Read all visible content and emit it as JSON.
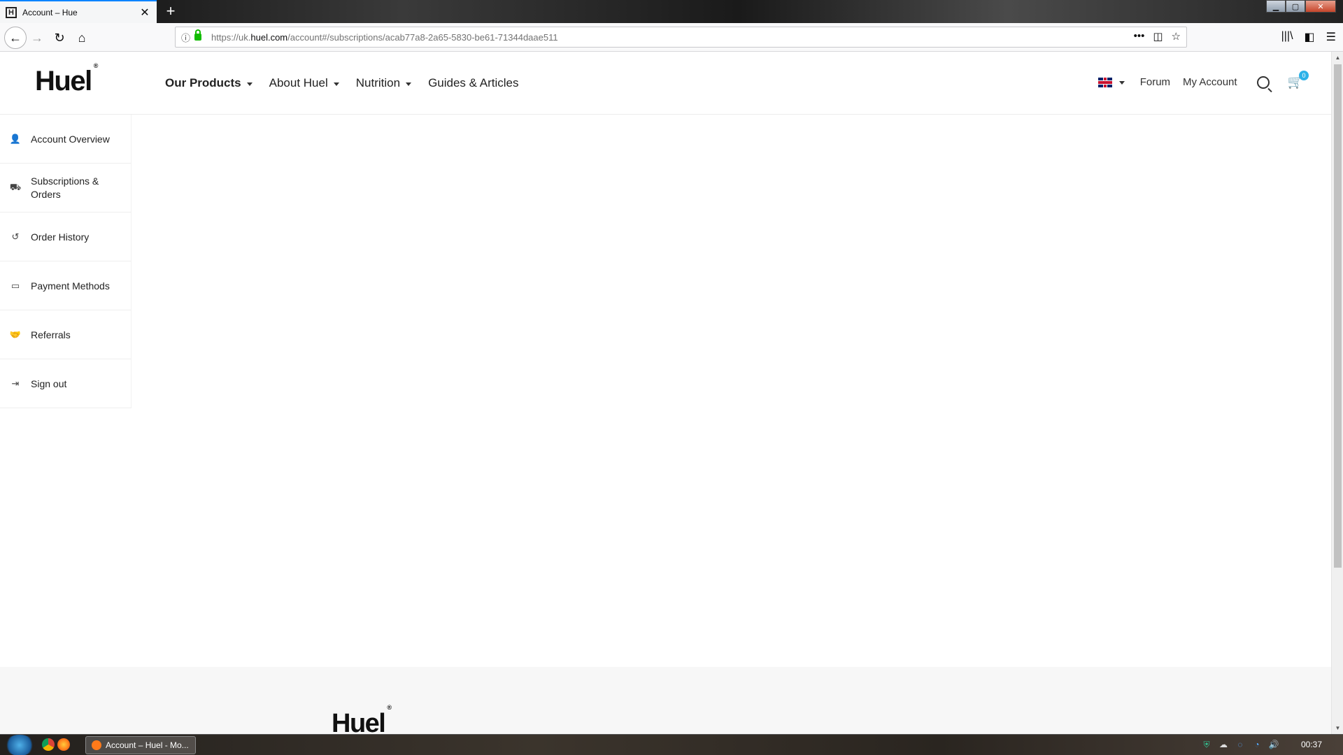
{
  "browser": {
    "tab_title": "Account – Hue",
    "tab_favicon": "H",
    "url_prefix": "https://uk.",
    "url_domain": "huel.com",
    "url_path": "/account#/subscriptions/acab77a8-2a65-5830-be61-71344daae511"
  },
  "header": {
    "logo": "Huel",
    "logo_mark": "®",
    "nav": [
      {
        "label": "Our Products"
      },
      {
        "label": "About Huel"
      },
      {
        "label": "Nutrition"
      },
      {
        "label": "Guides & Articles"
      }
    ],
    "forum": "Forum",
    "my_account": "My Account",
    "cart_count": "0"
  },
  "sidebar": {
    "items": [
      {
        "label": "Account Overview",
        "icon": "user-icon"
      },
      {
        "label": "Subscriptions & Orders",
        "icon": "truck-icon"
      },
      {
        "label": "Order History",
        "icon": "history-icon"
      },
      {
        "label": "Payment Methods",
        "icon": "card-icon"
      },
      {
        "label": "Referrals",
        "icon": "handshake-icon"
      },
      {
        "label": "Sign out",
        "icon": "sign-out-icon"
      }
    ]
  },
  "footer": {
    "logo": "Huel",
    "logo_mark": "®"
  },
  "taskbar": {
    "task_label": "Account – Huel - Mo...",
    "clock": "00:37"
  }
}
